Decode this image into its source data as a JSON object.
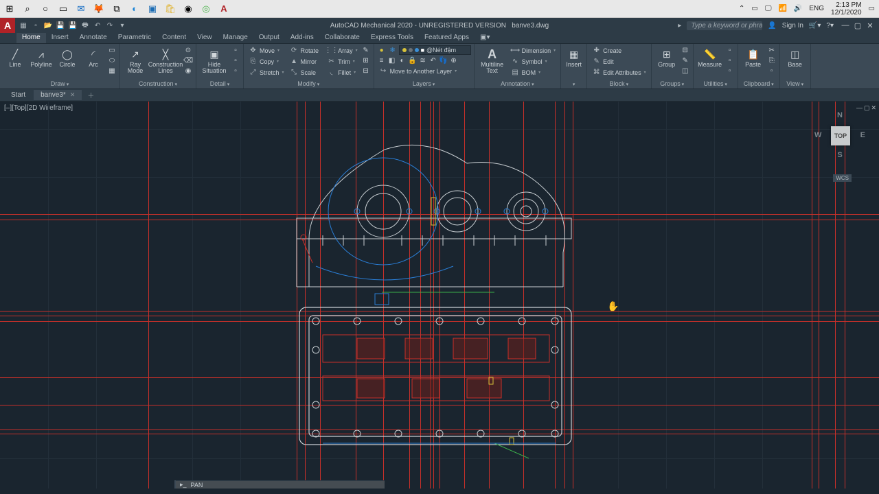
{
  "taskbar": {
    "clock_time": "2:13 PM",
    "clock_date": "12/1/2020",
    "lang": "ENG"
  },
  "title": {
    "app": "AutoCAD Mechanical 2020 - UNREGISTERED VERSION",
    "file": "banve3.dwg",
    "search_placeholder": "Type a keyword or phrase",
    "signin": "Sign In"
  },
  "menu": {
    "tabs": [
      "Home",
      "Insert",
      "Annotate",
      "Parametric",
      "Content",
      "View",
      "Manage",
      "Output",
      "Add-ins",
      "Collaborate",
      "Express Tools",
      "Featured Apps"
    ],
    "active": 0
  },
  "ribbon": {
    "draw": {
      "label": "Draw",
      "line": "Line",
      "polyline": "Polyline",
      "circle": "Circle",
      "arc": "Arc"
    },
    "construction": {
      "label": "Construction",
      "ray": "Ray\nMode",
      "clines": "Construction\nLines",
      "hide": "Hide\nSituation"
    },
    "detail": {
      "label": "Detail"
    },
    "modify": {
      "label": "Modify",
      "move": "Move",
      "rotate": "Rotate",
      "array": "Array",
      "copy": "Copy",
      "mirror": "Mirror",
      "trim": "Trim",
      "stretch": "Stretch",
      "scale": "Scale",
      "fillet": "Fillet"
    },
    "layers": {
      "label": "Layers",
      "current": "@Nét đậm",
      "moveto": "Move to Another Layer"
    },
    "annotation": {
      "label": "Annotation",
      "multiline": "Multiline\nText",
      "dimension": "Dimension",
      "symbol": "Symbol",
      "bom": "BOM"
    },
    "insert": {
      "label": "Insert",
      "insert": "Insert"
    },
    "block": {
      "label": "Block",
      "create": "Create",
      "edit": "Edit",
      "editattr": "Edit Attributes"
    },
    "groups": {
      "label": "Groups",
      "group": "Group"
    },
    "utilities": {
      "label": "Utilities",
      "measure": "Measure"
    },
    "clipboard": {
      "label": "Clipboard",
      "paste": "Paste"
    },
    "view": {
      "label": "View",
      "base": "Base"
    }
  },
  "filetabs": {
    "start": "Start",
    "file": "banve3*"
  },
  "viewport": {
    "label": "[–][Top][2D Wireframe]"
  },
  "viewcube": {
    "face": "TOP",
    "n": "N",
    "s": "S",
    "e": "E",
    "w": "W",
    "wcs": "WCS"
  },
  "cmd": {
    "text": "PAN"
  }
}
